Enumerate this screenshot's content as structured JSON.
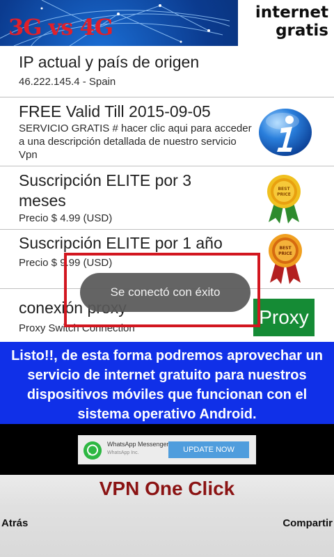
{
  "banner": {
    "left_text": "3G vs 4G",
    "badge_line1": "internet",
    "badge_line2": "gratis"
  },
  "list": {
    "ip": {
      "title": "IP actual y país de origen",
      "subtitle": "46.222.145.4 - Spain"
    },
    "free": {
      "title": "FREE Valid Till 2015-09-05",
      "subtitle": "SERVICIO GRATIS # hacer clic aqui para acceder a una descripción detallada de nuestro servicio Vpn",
      "icon": "info-icon"
    },
    "elite3": {
      "title": "Suscripción ELITE por 3 meses",
      "subtitle": "Precio $ 4.99 (USD)",
      "icon": "best-price-medal-icon"
    },
    "elite1": {
      "title": "Suscripción ELITE por 1 año",
      "subtitle": "Precio $ 9.99 (USD)",
      "icon": "best-price-medal-icon"
    },
    "proxy": {
      "title": "conexión proxy",
      "subtitle": "Proxy Switch Connection",
      "button": "Proxy"
    }
  },
  "toast": {
    "text": "Se conectó con éxito"
  },
  "caption": {
    "text": "Listo!!, de esta forma podremos aprovechar un servicio de internet gratuito para nuestros dispositivos móviles que funcionan con el sistema operativo Android."
  },
  "ad": {
    "app_name": "WhatsApp Messenger",
    "publisher": "WhatsApp Inc.",
    "button": "UPDATE NOW",
    "icon": "whatsapp-icon"
  },
  "footer": {
    "title": "VPN One Click",
    "back": "Atrás",
    "share": "Compartir"
  },
  "colors": {
    "banner_blue": "#0b3b8f",
    "caption_blue": "#1030e8",
    "highlight_red": "#d2161f",
    "proxy_green": "#158b35",
    "title_red": "#8b1313"
  }
}
